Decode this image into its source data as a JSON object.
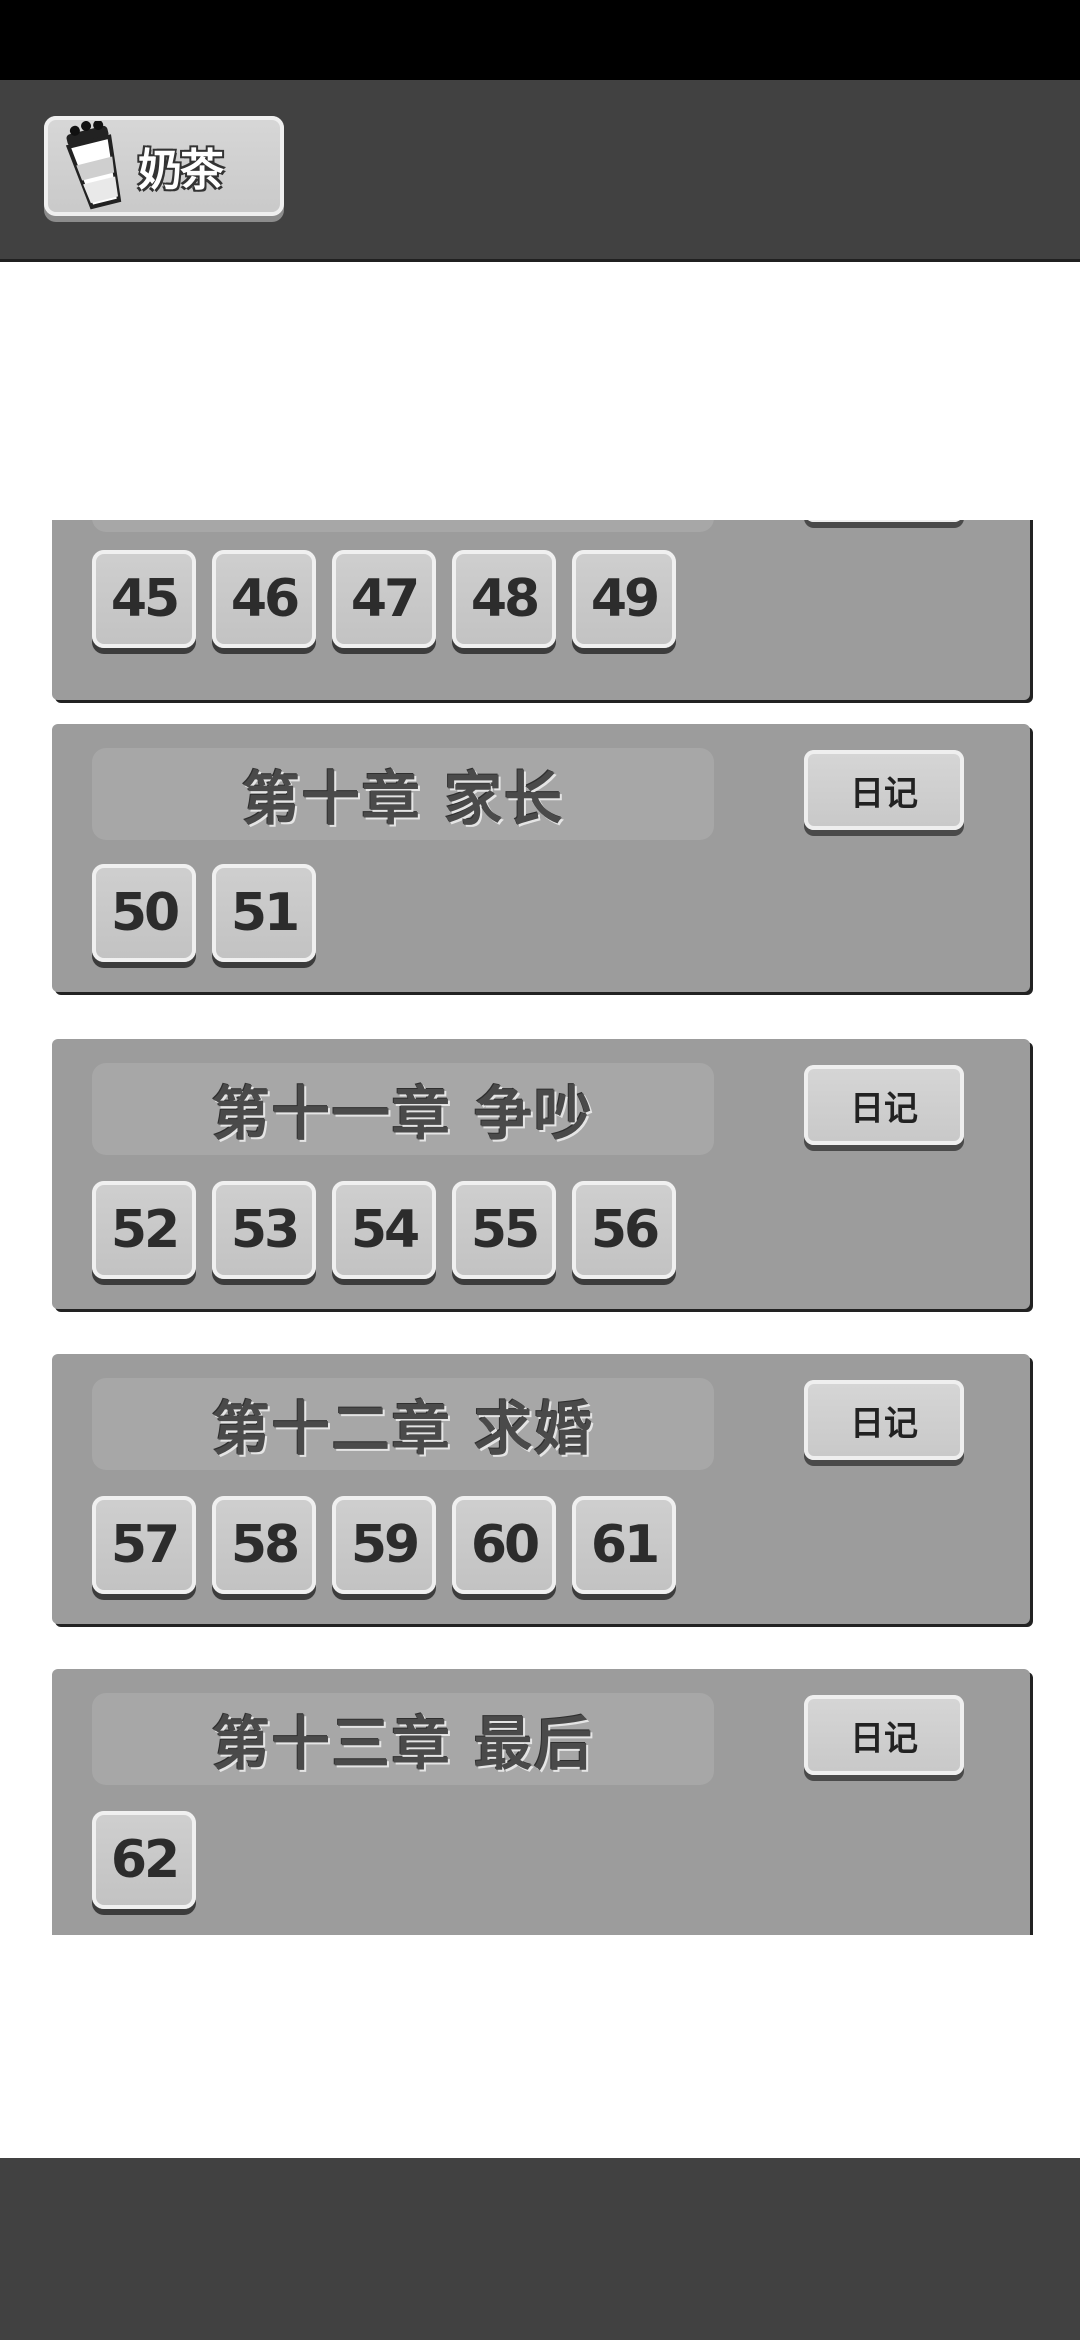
{
  "topbar": {
    "milk_tea_label": "奶茶"
  },
  "chapters": [
    {
      "title": "",
      "diary_label": "",
      "levels": [
        "45",
        "46",
        "47",
        "48",
        "49"
      ]
    },
    {
      "title": "第十章 家长",
      "diary_label": "日记",
      "levels": [
        "50",
        "51"
      ]
    },
    {
      "title": "第十一章 争吵",
      "diary_label": "日记",
      "levels": [
        "52",
        "53",
        "54",
        "55",
        "56"
      ]
    },
    {
      "title": "第十二章 求婚",
      "diary_label": "日记",
      "levels": [
        "57",
        "58",
        "59",
        "60",
        "61"
      ]
    },
    {
      "title": "第十三章 最后",
      "diary_label": "日记",
      "levels": [
        "62"
      ]
    }
  ]
}
